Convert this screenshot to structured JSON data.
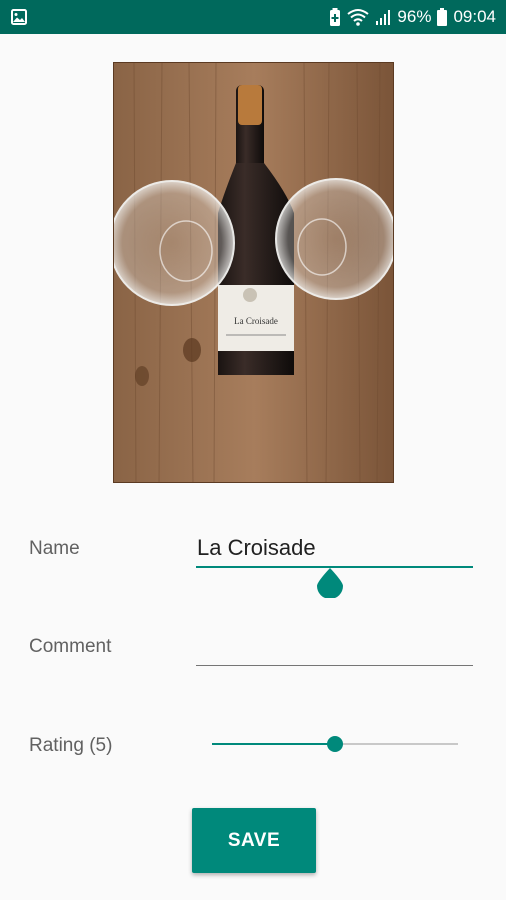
{
  "status_bar": {
    "battery": "96%",
    "time": "09:04",
    "icons": [
      "image-notification-icon",
      "battery-saver-icon",
      "wifi-icon",
      "signal-icon",
      "battery-icon"
    ]
  },
  "colors": {
    "status_bar": "#00695c",
    "accent": "#00897b",
    "background": "#fafafa"
  },
  "photo": {
    "subject": "wine bottle with two glasses on wooden table",
    "label_text": "La Croisade"
  },
  "form": {
    "name_label": "Name",
    "name_value": "La Croisade",
    "comment_label": "Comment",
    "comment_value": "",
    "rating_label": "Rating (5)",
    "rating_value": 5,
    "rating_max": 10
  },
  "actions": {
    "save_label": "SAVE"
  }
}
